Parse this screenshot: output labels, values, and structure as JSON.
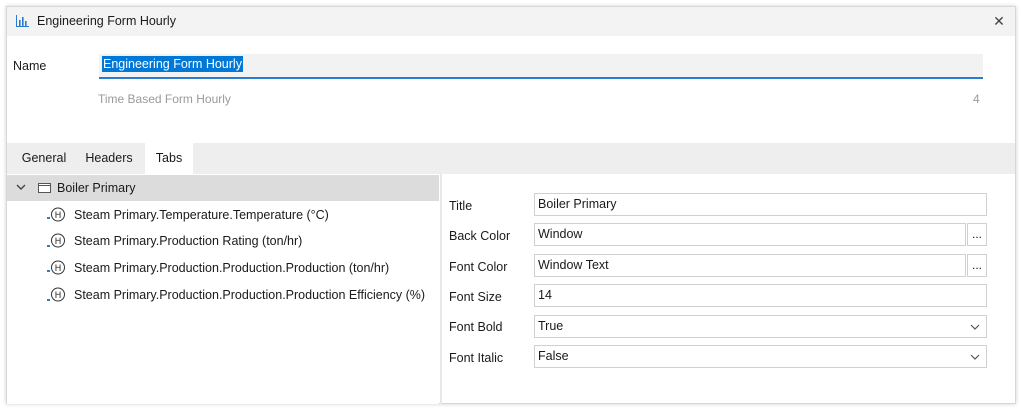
{
  "window": {
    "title": "Engineering Form Hourly"
  },
  "form": {
    "name_label": "Name",
    "name_value": "Engineering Form Hourly",
    "subtitle": "Time Based Form Hourly",
    "count": "4"
  },
  "tabs": [
    {
      "label": "General"
    },
    {
      "label": "Headers"
    },
    {
      "label": "Tabs",
      "active": true
    }
  ],
  "tree": {
    "root": "Boiler Primary",
    "items": [
      {
        "label": "Steam Primary.Temperature.Temperature (°C)"
      },
      {
        "label": "Steam Primary.Production Rating (ton/hr)"
      },
      {
        "label": "Steam Primary.Production.Production.Production (ton/hr)"
      },
      {
        "label": "Steam Primary.Production.Production.Production Efficiency (%)"
      }
    ]
  },
  "properties": {
    "title_label": "Title",
    "title_value": "Boiler Primary",
    "back_color_label": "Back Color",
    "back_color_value": "Window",
    "font_color_label": "Font Color",
    "font_color_value": "Window Text",
    "font_size_label": "Font Size",
    "font_size_value": "14",
    "font_bold_label": "Font Bold",
    "font_bold_value": "True",
    "font_italic_label": "Font Italic",
    "font_italic_value": "False",
    "ellipsis_label": "..."
  },
  "colors": {
    "accent": "#0078d7",
    "selection_bg": "#dcdcdc",
    "tabbar_bg": "#eeeeee"
  },
  "icons": {
    "title": "chart-icon",
    "close": "close-icon",
    "expand": "chevron-down-icon",
    "folder": "folder-icon",
    "tag": "historian-tag-icon",
    "dropdown": "chevron-down-icon"
  }
}
